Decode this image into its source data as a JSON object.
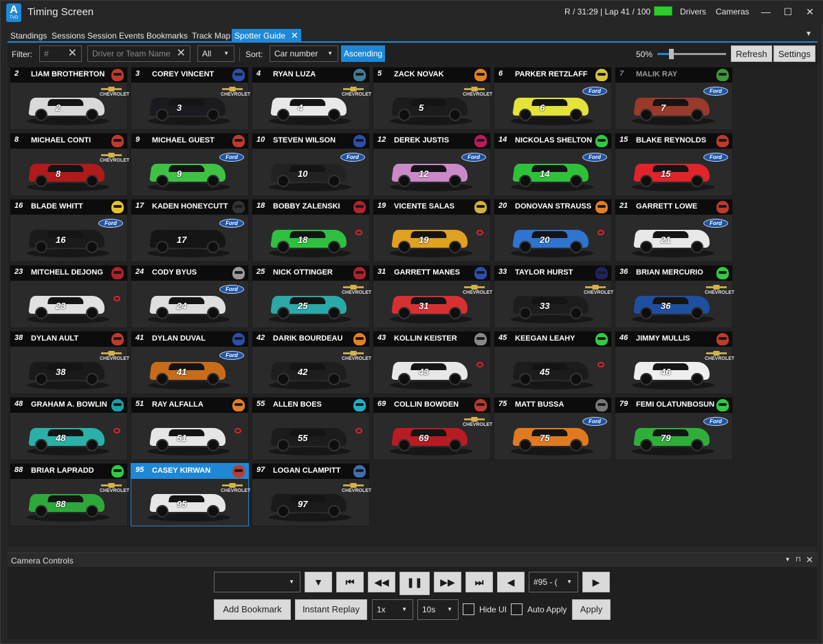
{
  "window": {
    "title": "Timing Screen",
    "logo_letter": "A",
    "logo_sub": "TVO",
    "session": "R / 31:29 | Lap 41 / 100",
    "drivers_label": "Drivers",
    "cameras_label": "Cameras",
    "minimize_glyph": "—",
    "maximize_glyph": "☐",
    "close_glyph": "✕"
  },
  "tabs": [
    {
      "label": "Standings"
    },
    {
      "label": "Sessions"
    },
    {
      "label": "Session Events"
    },
    {
      "label": "Bookmarks"
    },
    {
      "label": "Track Map"
    },
    {
      "label": "Spotter Guide",
      "active": true,
      "close": "✕"
    }
  ],
  "tab_menu_glyph": "▼",
  "toolbar": {
    "filter_label": "Filter:",
    "number_placeholder": "#",
    "name_placeholder": "Driver or Team Name",
    "clear_glyph": "✕",
    "class_value": "All",
    "sort_label": "Sort:",
    "sort_value": "Car number",
    "order_label": "Ascending",
    "zoom_text": "50%",
    "zoom_level": 0.2,
    "refresh_label": "Refresh",
    "settings_label": "Settings"
  },
  "cards": [
    {
      "num": "2",
      "name": "LIAM BROTHERTON",
      "make": "chevrolet",
      "color": "#d9d9d9",
      "helmet": "#c0392b"
    },
    {
      "num": "3",
      "name": "COREY VINCENT",
      "make": "chevrolet",
      "color": "#1b1b1f",
      "helmet": "#2a4fb0"
    },
    {
      "num": "4",
      "name": "RYAN  LUZA",
      "make": "chevrolet",
      "color": "#e8e8e8",
      "helmet": "#3c7d9a"
    },
    {
      "num": "5",
      "name": "ZACK NOVAK",
      "make": "chevrolet",
      "color": "#1c1c1c",
      "helmet": "#e67e22"
    },
    {
      "num": "6",
      "name": "PARKER RETZLAFF",
      "make": "ford",
      "color": "#e4e33a",
      "helmet": "#d4c53a"
    },
    {
      "num": "7",
      "name": "MALIK RAY",
      "make": "ford",
      "color": "#9a3a2a",
      "helmet": "#3a9a3a",
      "dim": true
    },
    {
      "num": "8",
      "name": "MICHAEL CONTI",
      "make": "chevrolet",
      "color": "#b01a1a",
      "helmet": "#c0392b"
    },
    {
      "num": "9",
      "name": "MICHAEL GUEST",
      "make": "ford",
      "color": "#3fc244",
      "helmet": "#c0392b"
    },
    {
      "num": "10",
      "name": "STEVEN  WILSON",
      "make": "ford",
      "color": "#222222",
      "helmet": "#2a4fb0"
    },
    {
      "num": "12",
      "name": "DEREK JUSTIS",
      "make": "ford",
      "color": "#c98ac7",
      "helmet": "#c2185b"
    },
    {
      "num": "14",
      "name": "NICKOLAS SHELTON",
      "make": "ford",
      "color": "#2ec23a",
      "helmet": "#2ecc40"
    },
    {
      "num": "15",
      "name": "BLAKE REYNOLDS",
      "make": "ford",
      "color": "#e0242a",
      "helmet": "#c0392b"
    },
    {
      "num": "16",
      "name": "BLADE WHITT",
      "make": "ford",
      "color": "#1a1a1a",
      "helmet": "#e6c32a"
    },
    {
      "num": "17",
      "name": "KADEN HONEYCUTT",
      "make": "ford",
      "color": "#151515",
      "helmet": "#333333"
    },
    {
      "num": "18",
      "name": "BOBBY ZALENSKI",
      "make": "toyota",
      "color": "#2fc040",
      "helmet": "#b0232a"
    },
    {
      "num": "19",
      "name": "VICENTE SALAS",
      "make": "toyota",
      "color": "#e0a020",
      "helmet": "#d4b03a"
    },
    {
      "num": "20",
      "name": "DONOVAN STRAUSS",
      "make": "toyota",
      "color": "#2f74d0",
      "helmet": "#e67e22"
    },
    {
      "num": "21",
      "name": "GARRETT LOWE",
      "make": "ford",
      "color": "#e8e8e8",
      "helmet": "#c0392b"
    },
    {
      "num": "23",
      "name": "MITCHELL DEJONG",
      "make": "toyota",
      "color": "#e0e0e0",
      "helmet": "#b0232a"
    },
    {
      "num": "24",
      "name": "CODY BYUS",
      "make": "ford",
      "color": "#dedede",
      "helmet": "#999999"
    },
    {
      "num": "25",
      "name": "NICK OTTINGER",
      "make": "chevrolet",
      "color": "#2aa9a8",
      "helmet": "#b0232a"
    },
    {
      "num": "31",
      "name": "GARRETT MANES",
      "make": "chevrolet",
      "color": "#d83030",
      "helmet": "#2a4fb0"
    },
    {
      "num": "33",
      "name": "TAYLOR HURST",
      "make": "chevrolet",
      "color": "#1d1d1d",
      "helmet": "#222266"
    },
    {
      "num": "36",
      "name": "BRIAN MERCURIO",
      "make": "chevrolet",
      "color": "#1f4fa0",
      "helmet": "#2ecc40"
    },
    {
      "num": "38",
      "name": "DYLAN AULT",
      "make": "chevrolet",
      "color": "#1a1a1a",
      "helmet": "#c0392b"
    },
    {
      "num": "41",
      "name": "DYLAN DUVAL",
      "make": "ford",
      "color": "#c86c1a",
      "helmet": "#2a4fb0"
    },
    {
      "num": "42",
      "name": "DARIK BOURDEAU",
      "make": "chevrolet",
      "color": "#1e1e1e",
      "helmet": "#e67e22"
    },
    {
      "num": "43",
      "name": "KOLLIN KEISTER",
      "make": "toyota",
      "color": "#e8e8e8",
      "helmet": "#888888"
    },
    {
      "num": "45",
      "name": "KEEGAN LEAHY",
      "make": "toyota",
      "color": "#1c1c1c",
      "helmet": "#2ecc40"
    },
    {
      "num": "46",
      "name": "JIMMY MULLIS",
      "make": "chevrolet",
      "color": "#eeeeee",
      "helmet": "#c0392b"
    },
    {
      "num": "48",
      "name": "GRAHAM A. BOWLIN",
      "make": "toyota",
      "color": "#2ab0a8",
      "helmet": "#1aa0a8"
    },
    {
      "num": "51",
      "name": "RAY ALFALLA",
      "make": "toyota",
      "color": "#e6e6e6",
      "helmet": "#e67e22"
    },
    {
      "num": "55",
      "name": "ALLEN BOES",
      "make": "toyota",
      "color": "#1c1c1c",
      "helmet": "#1ab0c8"
    },
    {
      "num": "69",
      "name": "COLLIN BOWDEN",
      "make": "chevrolet",
      "color": "#b81c22",
      "helmet": "#c0392b"
    },
    {
      "num": "75",
      "name": "MATT BUSSA",
      "make": "ford",
      "color": "#e07a20",
      "helmet": "#777777"
    },
    {
      "num": "79",
      "name": "FEMI OLATUNBOSUN",
      "make": "ford",
      "color": "#2fae3a",
      "helmet": "#2ecc40"
    },
    {
      "num": "88",
      "name": "BRIAR LAPRADD",
      "make": "chevrolet",
      "color": "#2ea83a",
      "helmet": "#2ecc40"
    },
    {
      "num": "95",
      "name": "CASEY KIRWAN",
      "make": "chevrolet",
      "color": "#e6e6e6",
      "helmet": "#c0392b",
      "selected": true
    },
    {
      "num": "97",
      "name": "LOGAN CLAMPITT",
      "make": "chevrolet",
      "color": "#1a1a1a",
      "helmet": "#3c6fb0"
    }
  ],
  "brand_text": {
    "chevrolet": "CHEVROLET",
    "ford": "Ford",
    "toyota": ""
  },
  "camera": {
    "title": "Camera Controls",
    "pin_glyph": "▾",
    "dock_glyph": "⊓",
    "close_glyph": "✕",
    "camera_select": "",
    "car_select": "#95 - (",
    "add_bookmark": "Add Bookmark",
    "instant_replay": "Instant Replay",
    "speed": "1x",
    "duration": "10s",
    "hide_ui": "Hide UI",
    "auto_apply": "Auto Apply",
    "apply": "Apply",
    "icons": {
      "down": "▼",
      "first": "⏮",
      "rewind": "◀◀",
      "pause": "❚❚",
      "ffwd": "▶▶",
      "last": "⏭",
      "prev": "◀",
      "next": "▶",
      "arrow": "▼"
    }
  }
}
